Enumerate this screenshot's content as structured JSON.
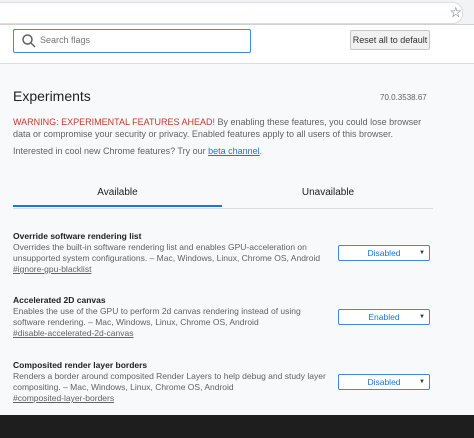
{
  "browser": {
    "star_icon": "star-icon"
  },
  "header": {
    "search_placeholder": "Search flags",
    "reset_label": "Reset all to default"
  },
  "main": {
    "title": "Experiments",
    "version": "70.0.3538.67",
    "warning_prefix": "WARNING: EXPERIMENTAL FEATURES AHEAD!",
    "warning_text": " By enabling these features, you could lose browser data or compromise your security or privacy. Enabled features apply to all users of this browser.",
    "interested_text": "Interested in cool new Chrome features? Try our ",
    "interested_link": "beta channel",
    "interested_end": "."
  },
  "tabs": [
    {
      "label": "Available"
    },
    {
      "label": "Unavailable"
    }
  ],
  "flags": [
    {
      "name": "Override software rendering list",
      "description": "Overrides the built-in software rendering list and enables GPU-acceleration on unsupported system configurations. – Mac, Windows, Linux, Chrome OS, Android",
      "link": "#ignore-gpu-blacklist",
      "value": "Disabled"
    },
    {
      "name": "Accelerated 2D canvas",
      "description": "Enables the use of the GPU to perform 2d canvas rendering instead of using software rendering. – Mac, Windows, Linux, Chrome OS, Android",
      "link": "#disable-accelerated-2d-canvas",
      "value": "Enabled"
    },
    {
      "name": "Composited render layer borders",
      "description": "Renders a border around composited Render Layers to help debug and study layer compositing. – Mac, Windows, Linux, Chrome OS, Android",
      "link": "#composited-layer-borders",
      "value": "Disabled"
    }
  ]
}
